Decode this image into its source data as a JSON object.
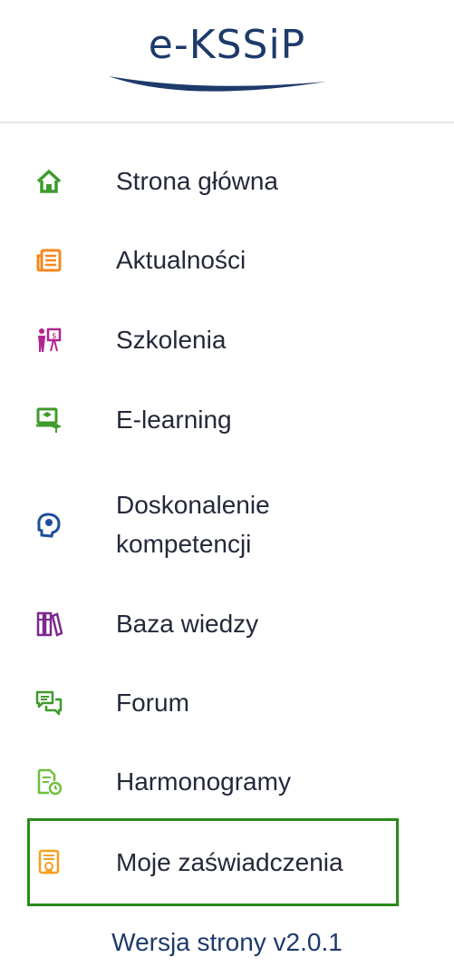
{
  "logo": {
    "text": "e-KSSiP"
  },
  "nav": {
    "items": [
      {
        "label": "Strona główna",
        "icon": "home-icon",
        "color": "#3f9b2c"
      },
      {
        "label": "Aktualności",
        "icon": "newspaper-icon",
        "color": "#f5871f"
      },
      {
        "label": "Szkolenia",
        "icon": "trainer-presentation-icon",
        "color": "#b0258f"
      },
      {
        "label": "E-learning",
        "icon": "elearning-monitor-icon",
        "color": "#3f9b2c"
      },
      {
        "label_line1": "Doskonalenie",
        "label_line2": "kompetencji",
        "icon": "head-gear-icon",
        "color": "#1d4f9a"
      },
      {
        "label": "Baza wiedzy",
        "icon": "books-icon",
        "color": "#7b2a8e"
      },
      {
        "label": "Forum",
        "icon": "chat-bubbles-icon",
        "color": "#3f9b2c"
      },
      {
        "label": "Harmonogramy",
        "icon": "schedule-document-icon",
        "color": "#6fbf3f"
      },
      {
        "label": "Moje zaświadczenia",
        "icon": "certificate-icon",
        "color": "#f5a01f",
        "active": true
      }
    ]
  },
  "active_border_color": "#2a8a1a",
  "footer": {
    "version": "Wersja strony v2.0.1"
  }
}
